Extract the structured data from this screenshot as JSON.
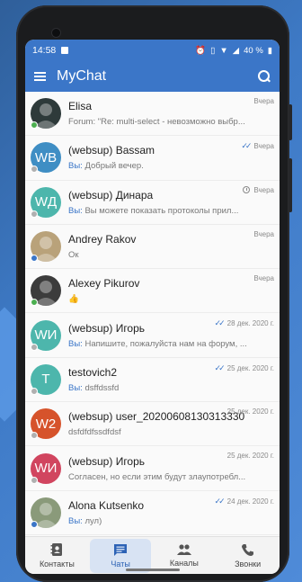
{
  "status": {
    "time": "14:58",
    "battery": "40 %"
  },
  "appbar": {
    "title": "MyChat"
  },
  "you_prefix": "Вы:",
  "chats": [
    {
      "name": "Elisa",
      "preview": "Forum: \"Re: multi-select - невозможно выбр...",
      "time": "Вчера",
      "status": "online",
      "avatar_type": "photo",
      "avatar_color": "#2e3a3a",
      "you": false
    },
    {
      "name": "(websup) Bassam",
      "preview": "Добрый вечер.",
      "time": "Вчера",
      "status": "offline",
      "avatar_type": "initials",
      "initials": "WB",
      "avatar_color": "#3f8ec4",
      "you": true,
      "ticks": true
    },
    {
      "name": "(websup) Динара",
      "preview": "Вы можете показать протоколы прил...",
      "time": "Вчера",
      "status": "offline",
      "avatar_type": "initials",
      "initials": "WД",
      "avatar_color": "#4db6ac",
      "you": true,
      "clock": true
    },
    {
      "name": "Andrey Rakov",
      "preview": "Ок",
      "time": "Вчера",
      "status": "blue",
      "avatar_type": "photo",
      "avatar_color": "#b9a27a",
      "you": false
    },
    {
      "name": "Alexey Pikurov",
      "preview": "👍",
      "time": "Вчера",
      "status": "online",
      "avatar_type": "photo",
      "avatar_color": "#3c3c3c",
      "you": false
    },
    {
      "name": "(websup) Игорь",
      "preview": "Напишите, пожалуйста нам на форум, ...",
      "time": "28 дек. 2020 г.",
      "status": "offline",
      "avatar_type": "initials",
      "initials": "WИ",
      "avatar_color": "#4db6ac",
      "you": true,
      "ticks": true
    },
    {
      "name": "testovich2",
      "preview": "dsffdssfd",
      "time": "25 дек. 2020 г.",
      "status": "offline",
      "avatar_type": "initials",
      "initials": "T",
      "avatar_color": "#4db6ac",
      "you": true,
      "ticks": true
    },
    {
      "name": "(websup) user_20200608130313330",
      "preview": "dsfdfdfssdfdsf",
      "time": "25 дек. 2020 г.",
      "status": "offline",
      "avatar_type": "initials",
      "initials": "W2",
      "avatar_color": "#d6532b",
      "you": false
    },
    {
      "name": "(websup) Игорь",
      "preview": "Согласен, но если этим будут злаупотребл...",
      "time": "25 дек. 2020 г.",
      "status": "offline",
      "avatar_type": "initials",
      "initials": "WИ",
      "avatar_color": "#d1455f",
      "you": false
    },
    {
      "name": "Alona Kutsenko",
      "preview": "лул)",
      "time": "24 дек. 2020 г.",
      "status": "blue",
      "avatar_type": "photo",
      "avatar_color": "#8a9a7a",
      "you": true,
      "ticks": true
    }
  ],
  "bottomnav": {
    "contacts": "Контакты",
    "chats": "Чаты",
    "channels": "Каналы",
    "calls": "Звонки"
  }
}
